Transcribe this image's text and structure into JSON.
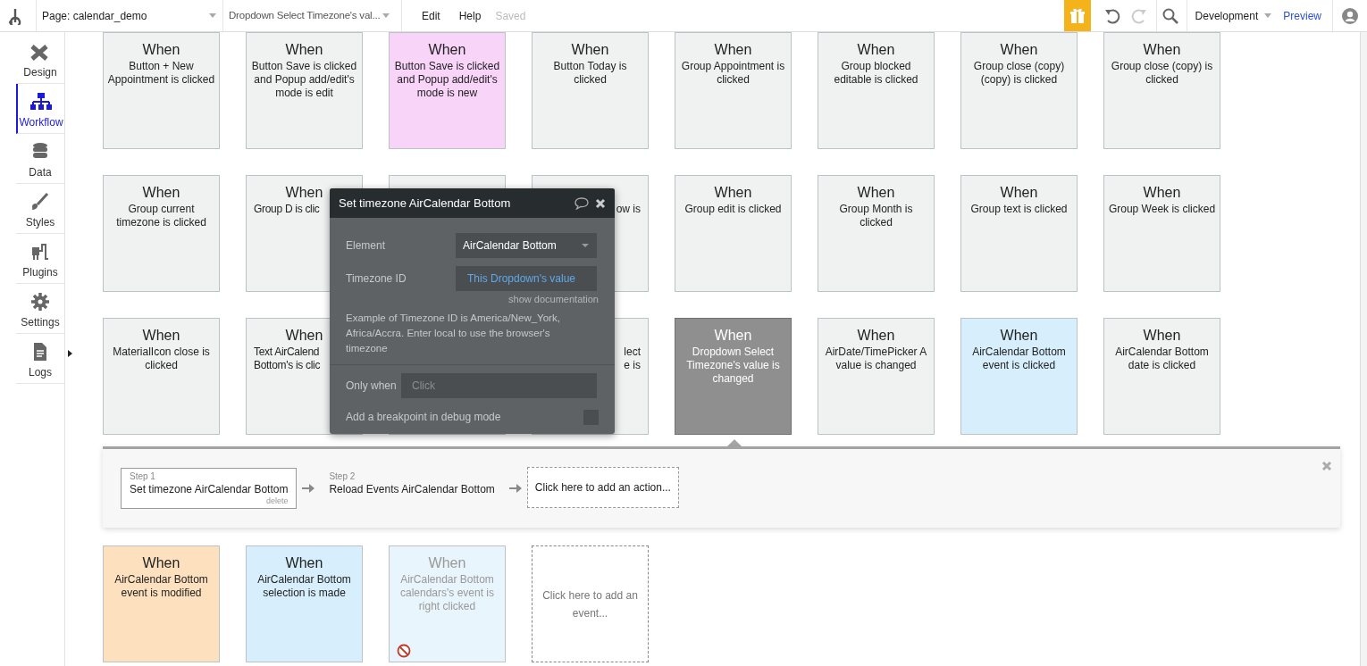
{
  "top_bar": {
    "page_selector": "Page: calendar_demo",
    "workflow_selector": "Dropdown Select Timezone's val...",
    "menu": [
      "Edit",
      "Help"
    ],
    "save_status": "Saved",
    "environment": "Development",
    "preview": "Preview"
  },
  "sidebar": {
    "items": [
      {
        "label": "Design",
        "selected": false
      },
      {
        "label": "Workflow",
        "selected": true
      },
      {
        "label": "Data",
        "selected": false
      },
      {
        "label": "Styles",
        "selected": false
      },
      {
        "label": "Plugins",
        "selected": false
      },
      {
        "label": "Settings",
        "selected": false
      },
      {
        "label": "Logs",
        "selected": false
      }
    ]
  },
  "event_rows_above": [
    [
      {
        "title": "When",
        "lines": [
          "Button + New",
          "Appointment is clicked"
        ],
        "color": "#f0f1f1",
        "selected": false
      },
      {
        "title": "When",
        "lines": [
          "Button Save is clicked",
          "and Popup add/edit's",
          "mode is edit"
        ],
        "color": "#f0f1f1",
        "selected": false
      },
      {
        "title": "When",
        "lines": [
          "Button Save is clicked",
          "and Popup add/edit's",
          "mode is new"
        ],
        "color": "#f8d4f8",
        "selected": false
      },
      {
        "title": "When",
        "lines": [
          "Button Today is",
          "clicked"
        ],
        "color": "#f0f1f1",
        "selected": false
      },
      {
        "title": "When",
        "lines": [
          "Group Appointment is",
          "clicked"
        ],
        "color": "#f0f1f1",
        "selected": false
      },
      {
        "title": "When",
        "lines": [
          "Group blocked",
          "editable is clicked"
        ],
        "color": "#f0f1f1",
        "selected": false
      },
      {
        "title": "When",
        "lines": [
          "Group close (copy)",
          "(copy) is clicked"
        ],
        "color": "#f0f1f1",
        "selected": false
      },
      {
        "title": "When",
        "lines": [
          "Group close (copy) is",
          "clicked"
        ],
        "color": "#f0f1f1",
        "selected": false
      }
    ],
    [
      {
        "title": "When",
        "lines": [
          "Group current",
          "timezone is clicked"
        ],
        "color": "#f0f1f1",
        "selected": false
      },
      {
        "kind": "cut_right",
        "title": "When",
        "lines": [
          "Group D is clic"
        ],
        "color": "#f0f1f1",
        "selected": false
      },
      {
        "kind": "covered"
      },
      {
        "kind": "cut_left",
        "lines": [
          "ow is"
        ],
        "color": "#f0f1f1",
        "selected": false
      },
      {
        "title": "When",
        "lines": [
          "Group edit is clicked"
        ],
        "color": "#f0f1f1",
        "selected": false
      },
      {
        "title": "When",
        "lines": [
          "Group Month is",
          "clicked"
        ],
        "color": "#f0f1f1",
        "selected": false
      },
      {
        "title": "When",
        "lines": [
          "Group text is clicked"
        ],
        "color": "#f0f1f1",
        "selected": false
      },
      {
        "title": "When",
        "lines": [
          "Group Week is clicked"
        ],
        "color": "#f0f1f1",
        "selected": false
      }
    ],
    [
      {
        "title": "When",
        "lines": [
          "MaterialIcon close is",
          "clicked"
        ],
        "color": "#f0f1f1",
        "selected": false
      },
      {
        "kind": "cut_right",
        "title": "When",
        "lines": [
          "Text AirCalend",
          "Bottom's is clic"
        ],
        "color": "#f0f1f1",
        "selected": false
      },
      {
        "kind": "covered"
      },
      {
        "kind": "cut_left",
        "lines": [
          "lect",
          "e is"
        ],
        "color": "#f0f1f1",
        "selected": false
      },
      {
        "title": "When",
        "lines": [
          "Dropdown Select",
          "Timezone's value is",
          "changed"
        ],
        "color": "#8f8f8f",
        "selected": true
      },
      {
        "title": "When",
        "lines": [
          "AirDate/TimePicker A",
          "value is changed"
        ],
        "color": "#f0f1f1",
        "selected": false
      },
      {
        "title": "When",
        "lines": [
          "AirCalendar Bottom",
          "event is clicked"
        ],
        "color": "#d7effc",
        "selected": false
      },
      {
        "title": "When",
        "lines": [
          "AirCalendar Bottom",
          "date is clicked"
        ],
        "color": "#f0f1f1",
        "selected": false
      }
    ]
  ],
  "actions_panel": {
    "steps": [
      {
        "step": "Step 1",
        "label": "Set timezone AirCalendar Bottom",
        "delete": "delete",
        "selected": true
      },
      {
        "step": "Step 2",
        "label": "Reload Events AirCalendar Bottom",
        "selected": false
      }
    ],
    "add_action": "Click here to add an action..."
  },
  "event_rows_below": [
    [
      {
        "title": "When",
        "lines": [
          "AirCalendar Bottom",
          "event is modified"
        ],
        "color": "#fde1be",
        "selected": false
      },
      {
        "title": "When",
        "lines": [
          "AirCalendar Bottom",
          "selection is made"
        ],
        "color": "#d7effc",
        "selected": false
      },
      {
        "title": "When",
        "lines": [
          "AirCalendar Bottom",
          "calendars's event is",
          "right clicked"
        ],
        "color": "#e8f5fd",
        "selected": false,
        "disabled": true
      },
      {
        "kind": "add",
        "lines": [
          "Click here to add an",
          "event..."
        ]
      }
    ]
  ],
  "popup": {
    "title": "Set timezone AirCalendar Bottom",
    "fields": [
      {
        "label": "Element",
        "kind": "dropdown",
        "value": "AirCalendar Bottom"
      },
      {
        "label": "Timezone ID",
        "kind": "expression",
        "value": "This Dropdown's value"
      }
    ],
    "doc_link": "show documentation",
    "description": "Example of Timezone ID is America/New_York, Africa/Accra. Enter local to use the browser's timezone",
    "only_when": {
      "label": "Only when",
      "placeholder": "Click"
    },
    "breakpoint": {
      "label": "Add a breakpoint in debug mode",
      "checked": false
    }
  }
}
